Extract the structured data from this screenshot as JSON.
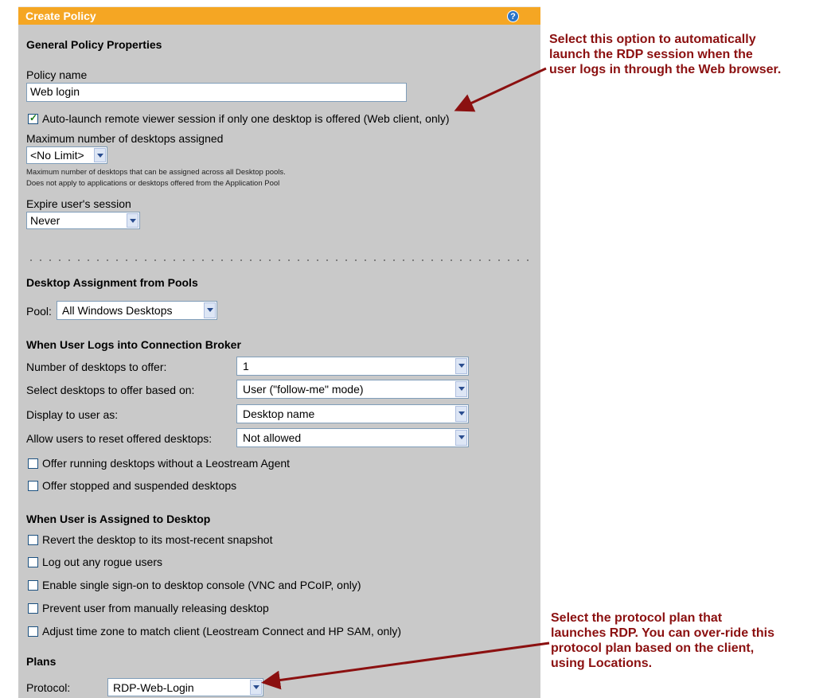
{
  "panel": {
    "title": "Create Policy",
    "help_icon": "?"
  },
  "general": {
    "heading": "General Policy Properties",
    "policy_name_label": "Policy name",
    "policy_name_value": "Web login",
    "auto_launch_label": "Auto-launch remote viewer session if only one desktop is offered (Web client, only)",
    "auto_launch_checked": true,
    "max_desktops_label": "Maximum number of desktops assigned",
    "max_desktops_value": "<No Limit>",
    "max_note_1": "Maximum number of desktops that can be assigned across all Desktop pools.",
    "max_note_2": "Does not apply to applications or desktops offered from the Application Pool",
    "expire_label": "Expire user's session",
    "expire_value": "Never"
  },
  "pools": {
    "heading": "Desktop Assignment from Pools",
    "pool_label": "Pool:",
    "pool_value": "All Windows Desktops"
  },
  "broker": {
    "heading": "When User Logs into Connection Broker",
    "rows": [
      {
        "label": "Number of desktops to offer:",
        "value": "1"
      },
      {
        "label": "Select desktops to offer based on:",
        "value": "User  (\"follow-me\" mode)"
      },
      {
        "label": "Display to user as:",
        "value": "Desktop name"
      },
      {
        "label": "Allow users to reset offered desktops:",
        "value": "Not allowed"
      }
    ],
    "checks": [
      {
        "label": "Offer running desktops without a Leostream Agent",
        "checked": false
      },
      {
        "label": "Offer stopped and suspended desktops",
        "checked": false
      }
    ]
  },
  "assigned": {
    "heading": "When User is Assigned to Desktop",
    "checks": [
      {
        "label": "Revert the desktop to its most-recent snapshot",
        "checked": false
      },
      {
        "label": "Log out any rogue users",
        "checked": false
      },
      {
        "label": "Enable single sign-on to desktop console (VNC and PCoIP, only)",
        "checked": false
      },
      {
        "label": "Prevent user from manually releasing desktop",
        "checked": false
      },
      {
        "label": "Adjust time zone to match client (Leostream Connect and HP SAM, only)",
        "checked": false
      }
    ]
  },
  "plans": {
    "heading": "Plans",
    "protocol_label": "Protocol:",
    "protocol_value": "RDP-Web-Login"
  },
  "annotations": {
    "top": [
      "Select this option to automatically",
      "launch the RDP session when the",
      "user logs in through the Web browser."
    ],
    "bottom": [
      "Select the protocol plan that",
      "launches RDP. You can over-ride this",
      "protocol plan based on the client,",
      "using Locations."
    ]
  },
  "colors": {
    "title_bar": "#f5a623",
    "panel": "#c9c9c9",
    "annotation": "#8b1010"
  }
}
